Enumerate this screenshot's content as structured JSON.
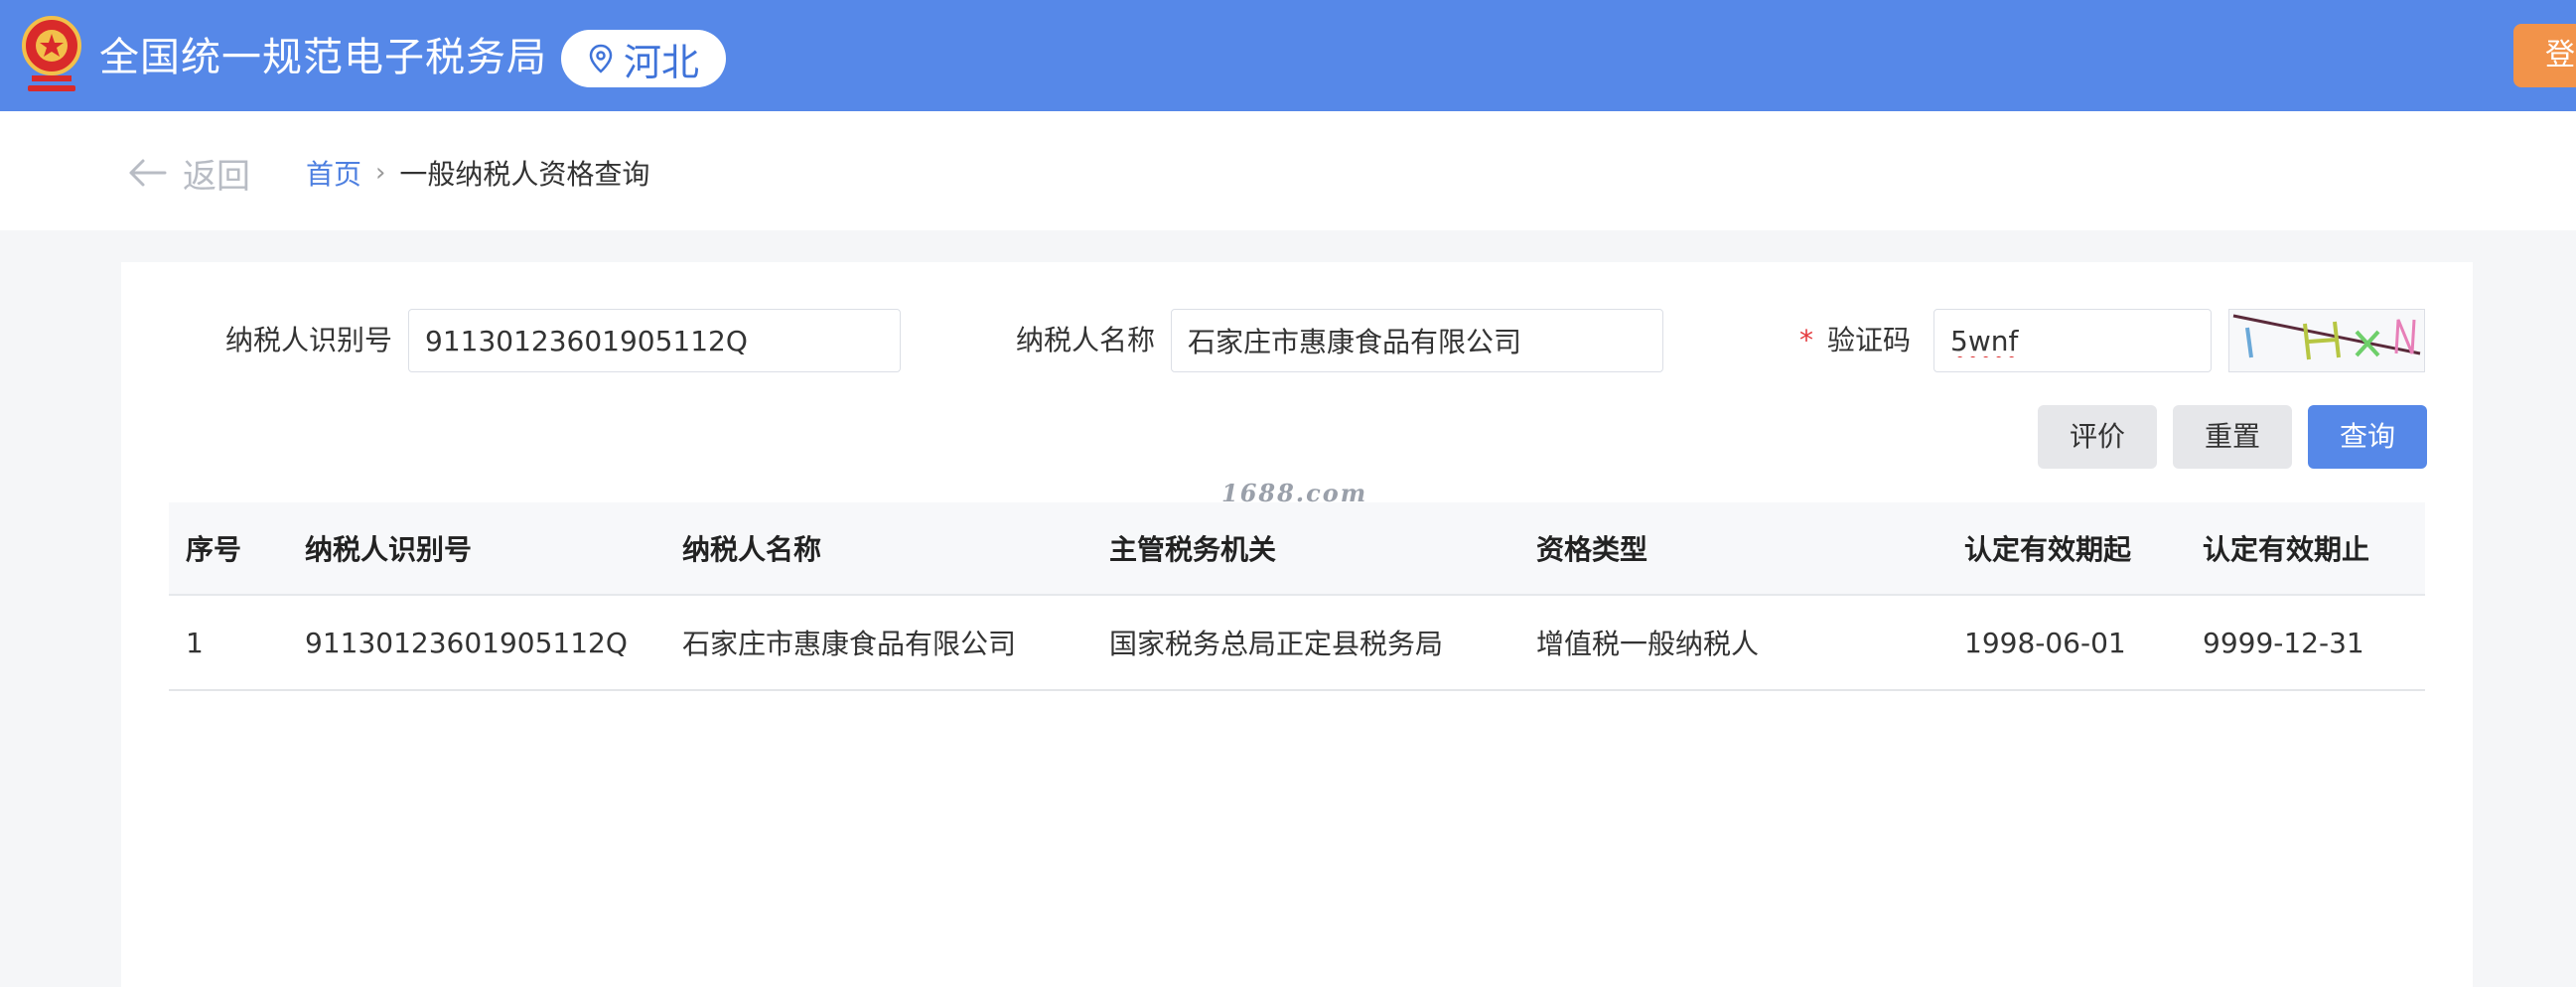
{
  "header": {
    "site_title": "全国统一规范电子税务局",
    "region": "河北",
    "login_label": "登录",
    "brand_color": "#5688e8"
  },
  "nav": {
    "back_label": "返回",
    "breadcrumb": {
      "home": "首页",
      "separator": "›",
      "current": "一般纳税人资格查询"
    }
  },
  "form": {
    "taxpayer_id_label": "纳税人识别号",
    "taxpayer_id_value": "91130123601905112Q",
    "taxpayer_name_label": "纳税人名称",
    "taxpayer_name_value": "石家庄市惠康食品有限公司",
    "captcha_required_mark": "*",
    "captcha_label": "验证码",
    "captcha_value": "5wnf"
  },
  "actions": {
    "evaluate_label": "评价",
    "reset_label": "重置",
    "query_label": "查询"
  },
  "watermark": "1688.com",
  "table": {
    "headers": [
      "序号",
      "纳税人识别号",
      "纳税人名称",
      "主管税务机关",
      "资格类型",
      "认定有效期起",
      "认定有效期止"
    ],
    "rows": [
      [
        "1",
        "91130123601905112Q",
        "石家庄市惠康食品有限公司",
        "国家税务总局正定县税务局",
        "增值税一般纳税人",
        "1998-06-01",
        "9999-12-31"
      ]
    ]
  }
}
